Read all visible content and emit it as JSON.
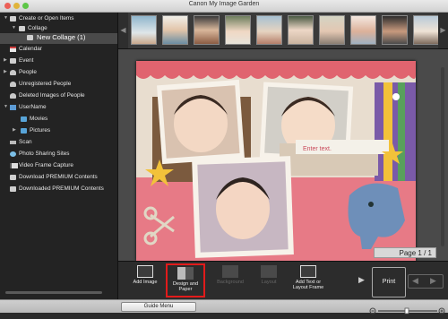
{
  "window": {
    "title": "Canon My Image Garden"
  },
  "sidebar": {
    "items": [
      {
        "label": "Create or Open Items",
        "expanded": true
      },
      {
        "label": "Collage",
        "expanded": true
      },
      {
        "label": "New Collage (1)",
        "selected": true
      },
      {
        "label": "Calendar"
      },
      {
        "label": "Event",
        "expandable": true
      },
      {
        "label": "People",
        "expandable": true
      },
      {
        "label": "Unregistered People"
      },
      {
        "label": "Deleted Images of People"
      },
      {
        "label": "UserName",
        "expanded": true
      },
      {
        "label": "Movies"
      },
      {
        "label": "Pictures",
        "expandable": true
      },
      {
        "label": "Scan"
      },
      {
        "label": "Photo Sharing Sites"
      },
      {
        "label": "Video Frame Capture"
      },
      {
        "label": "Download PREMIUM Contents"
      },
      {
        "label": "Downloaded PREMIUM Contents"
      }
    ]
  },
  "canvas": {
    "page_indicator": "Page 1 / 1",
    "text_box_placeholder": "Enter text."
  },
  "toolbar": {
    "tools": [
      {
        "label_line1": "Add Image",
        "label_line2": "",
        "enabled": true,
        "highlighted": false
      },
      {
        "label_line1": "Design and",
        "label_line2": "Paper",
        "enabled": true,
        "highlighted": true
      },
      {
        "label_line1": "Background",
        "label_line2": "",
        "enabled": false,
        "highlighted": false
      },
      {
        "label_line1": "Layout",
        "label_line2": "",
        "enabled": false,
        "highlighted": false
      },
      {
        "label_line1": "Add Text or",
        "label_line2": "Layout Frame",
        "enabled": true,
        "highlighted": false
      }
    ],
    "print_label": "Print"
  },
  "bottom": {
    "guide_menu_label": "Guide Menu"
  },
  "colors": {
    "highlight": "#e21b1b",
    "selection": "#4a4a4a",
    "page_background": "#e8e0d6"
  }
}
